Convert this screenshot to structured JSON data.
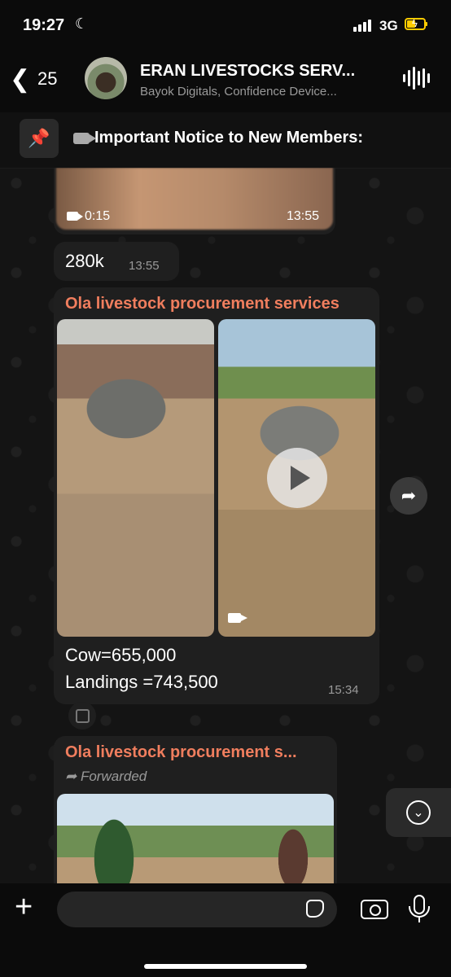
{
  "status_bar": {
    "time": "19:27",
    "network": "3G"
  },
  "header": {
    "back_count": "25",
    "title": "ERAN LIVESTOCKS SERV...",
    "subtitle": "Bayok Digitals, Confidence Device..."
  },
  "pinned": {
    "text": "Important Notice to New Members:"
  },
  "messages": {
    "video_top": {
      "duration": "0:15",
      "time": "13:55"
    },
    "price": {
      "text": "280k",
      "time": "13:55"
    },
    "main": {
      "sender": "Ola livestock procurement services",
      "line1": "Cow=655,000",
      "line2": "Landings =743,500",
      "time": "15:34"
    },
    "forwarded": {
      "sender": "Ola livestock procurement s...",
      "label": "Forwarded"
    }
  },
  "colors": {
    "sender": "#f07e5e",
    "bubble": "#1f1f1f",
    "battery": "#ffcc00"
  }
}
